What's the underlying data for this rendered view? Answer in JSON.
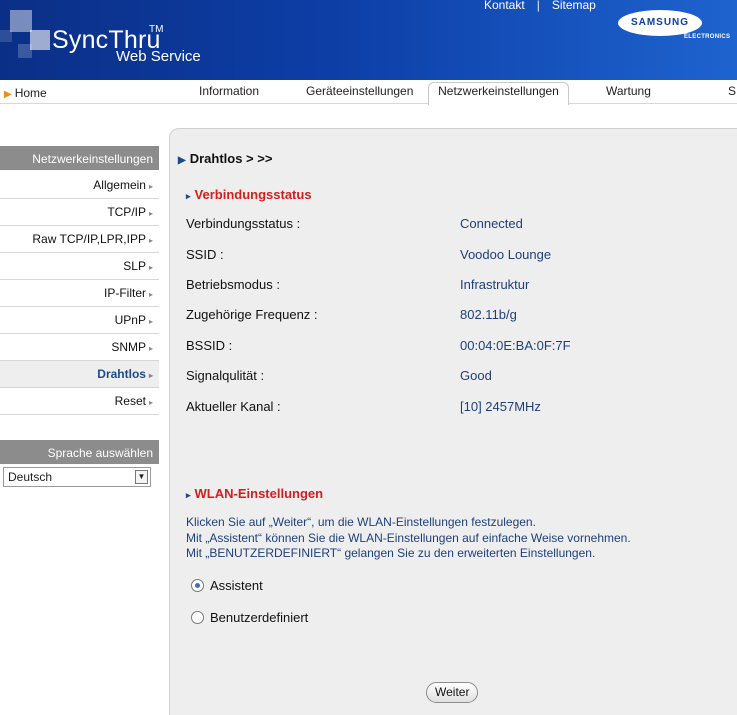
{
  "header": {
    "logo_main": "SyncThru",
    "logo_tm": "TM",
    "logo_sub": "Web Service",
    "links": {
      "contact": "Kontakt",
      "separator": "|",
      "sitemap": "Sitemap"
    },
    "brand": "SAMSUNG",
    "brand_sub": "ELECTRONICS"
  },
  "nav": {
    "home": "Home",
    "tabs": [
      {
        "label": "Information"
      },
      {
        "label": "Geräteeinstellungen"
      },
      {
        "label": "Netzwerkeinstellungen"
      },
      {
        "label": "Wartung"
      },
      {
        "label": "S"
      }
    ],
    "active_tab": "Netzwerkeinstellungen"
  },
  "sidebar": {
    "title": "Netzwerkeinstellungen",
    "items": [
      {
        "label": "Allgemein"
      },
      {
        "label": "TCP/IP"
      },
      {
        "label": "Raw TCP/IP,LPR,IPP"
      },
      {
        "label": "SLP"
      },
      {
        "label": "IP-Filter"
      },
      {
        "label": "UPnP"
      },
      {
        "label": "SNMP"
      },
      {
        "label": "Drahtlos"
      },
      {
        "label": "Reset"
      }
    ],
    "active_item": "Drahtlos",
    "language": {
      "title": "Sprache auswählen",
      "selected": "Deutsch"
    }
  },
  "main": {
    "breadcrumb": "Drahtlos > >>",
    "status_section": {
      "title": "Verbindungsstatus",
      "rows": [
        {
          "label": "Verbindungsstatus :",
          "value": "Connected"
        },
        {
          "label": "SSID :",
          "value": "Voodoo Lounge"
        },
        {
          "label": "Betriebsmodus :",
          "value": "Infrastruktur"
        },
        {
          "label": "Zugehörige Frequenz :",
          "value": "802.11b/g"
        },
        {
          "label": "BSSID :",
          "value": "00:04:0E:BA:0F:7F"
        },
        {
          "label": "Signalqulität :",
          "value": "Good"
        },
        {
          "label": "Aktueller Kanal :",
          "value": "[10] 2457MHz"
        }
      ]
    },
    "wlan_section": {
      "title": "WLAN-Einstellungen",
      "info_lines": [
        "Klicken Sie auf „Weiter“, um die WLAN-Einstellungen festzulegen.",
        "Mit „Assistent“ können Sie die WLAN-Einstellungen auf einfache Weise vornehmen.",
        "Mit „BENUTZERDEFINIERT“ gelangen Sie zu den erweiterten Einstellungen."
      ],
      "options": [
        {
          "label": "Assistent",
          "checked": true
        },
        {
          "label": "Benutzerdefiniert",
          "checked": false
        }
      ],
      "next_button": "Weiter"
    }
  },
  "icons": {
    "arrow": "arrow-right-icon",
    "chevron": "chevron-right-icon",
    "dropdown": "dropdown-arrow-icon"
  }
}
